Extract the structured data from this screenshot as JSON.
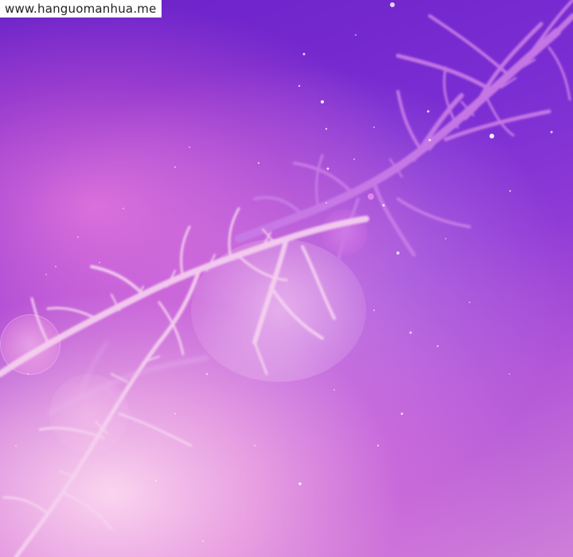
{
  "watermark": {
    "text": "www.hanguomanhua.me"
  },
  "colors": {
    "sky_top": "#6a22c8",
    "sky_mid": "#8e3ad6",
    "glow_pink": "#f8b4e4",
    "branch_purple": "#c87ae6",
    "branch_pale": "#f6d2f0"
  }
}
